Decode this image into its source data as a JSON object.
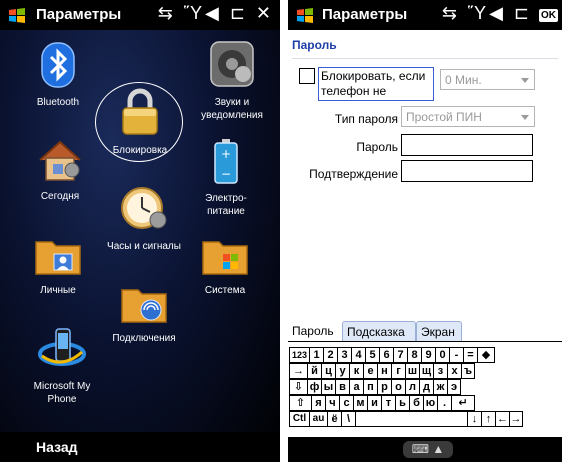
{
  "left": {
    "title": "Параметры",
    "status_icons": "⇆ Ὕ◀ ⊏ ✕",
    "back_label": "Назад",
    "apps": [
      {
        "label": "Bluetooth",
        "icon": "bluetooth-icon"
      },
      {
        "label": "Звуки и уведомления",
        "icon": "speaker-icon"
      },
      {
        "label": "Блокировка",
        "icon": "lock-icon"
      },
      {
        "label": "Сегодня",
        "icon": "home-icon"
      },
      {
        "label": "Электро-питание",
        "icon": "battery-icon"
      },
      {
        "label": "Часы и сигналы",
        "icon": "clock-icon"
      },
      {
        "label": "Личные",
        "icon": "personal-folder-icon"
      },
      {
        "label": "Система",
        "icon": "system-folder-icon"
      },
      {
        "label": "Подключения",
        "icon": "connections-folder-icon"
      },
      {
        "label": "Microsoft My Phone",
        "icon": "myphone-icon"
      }
    ]
  },
  "right": {
    "title": "Параметры",
    "status_icons": "⇆ Ὕ◀ ⊏",
    "ok_label": "OK",
    "page_title": "Пароль",
    "lock_label": "Блокировать, если телефон не",
    "lock_minutes": "0 Мин.",
    "password_type_label": "Тип пароля",
    "password_type_value": "Простой ПИН",
    "password_label": "Пароль",
    "confirm_label": "Подтверждение",
    "tabs": [
      "Пароль",
      "Подсказка",
      "Экран"
    ],
    "keyboard_button": "⌨ ▲"
  }
}
